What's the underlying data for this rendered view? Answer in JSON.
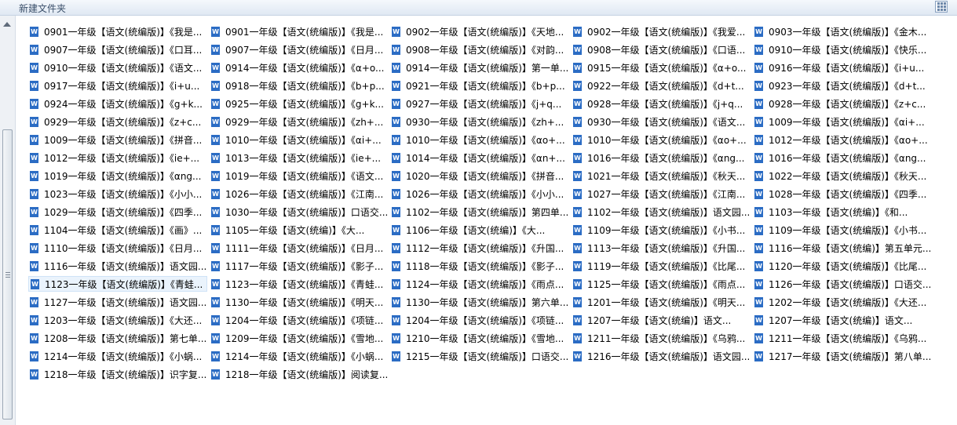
{
  "window": {
    "title": "新建文件夹"
  },
  "files": [
    "0901一年级【语文(统编版)】《我是...",
    "0901一年级【语文(统编版)】《我是...",
    "0902一年级【语文(统编版)】《天地...",
    "0902一年级【语文(统编版)】《我爱...",
    "0903一年级【语文(统编版)】《金木...",
    "0907一年级【语文(统编版)】《口耳...",
    "0907一年级【语文(统编版)】《日月...",
    "0908一年级【语文(统编版)】《对韵...",
    "0908一年级【语文(统编版)】《口语...",
    "0910一年级【语文(统编版)】《快乐...",
    "0910一年级【语文(统编版)】《语文...",
    "0914一年级【语文(统编版)】《α+o...",
    "0914一年级【语文(统编版)】第一单...",
    "0915一年级【语文(统编版)】《α+o...",
    "0916一年级【语文(统编版)】《i+u...",
    "0917一年级【语文(统编版)】《i+u...",
    "0918一年级【语文(统编版)】《b+p...",
    "0921一年级【语文(统编版)】《b+p...",
    "0922一年级【语文(统编版)】《d+t...",
    "0923一年级【语文(统编版)】《d+t...",
    "0924一年级【语文(统编版)】《g+k...",
    "0925一年级【语文(统编版)】《g+k...",
    "0927一年级【语文(统编版)】《j+q...",
    "0928一年级【语文(统编版)】《j+q...",
    "0928一年级【语文(统编版)】《z+c...",
    "0929一年级【语文(统编版)】《z+c...",
    "0929一年级【语文(统编版)】《zh+...",
    "0930一年级【语文(统编版)】《zh+...",
    "0930一年级【语文(统编版)】《语文...",
    "1009一年级【语文(统编版)】《αi+...",
    "1009一年级【语文(统编版)】《拼音...",
    "1010一年级【语文(统编版)】《αi+...",
    "1010一年级【语文(统编版)】《αo+...",
    "1010一年级【语文(统编版)】《αo+...",
    "1012一年级【语文(统编版)】《αo+...",
    "1012一年级【语文(统编版)】《ie+...",
    "1013一年级【语文(统编版)】《ie+...",
    "1014一年级【语文(统编版)】《αn+...",
    "1016一年级【语文(统编版)】《αng...",
    "1016一年级【语文(统编版)】《αng...",
    "1019一年级【语文(统编版)】《αng...",
    "1019一年级【语文(统编版)】《语文...",
    "1020一年级【语文(统编版)】《拼音...",
    "1021一年级【语文(统编版)】《秋天...",
    "1022一年级【语文(统编版)】《秋天...",
    "1023一年级【语文(统编版)】《小小...",
    "1026一年级【语文(统编版)】《江南...",
    "1026一年级【语文(统编版)】《小小...",
    "1027一年级【语文(统编版)】《江南...",
    "1028一年级【语文(统编版)】《四季...",
    "1029一年级【语文(统编版)】《四季...",
    "1030一年级【语文(统编版)】口语交...",
    "1102一年级【语文(统编版)】第四单...",
    "1102一年级【语文(统编版)】语文园...",
    "1103一年级【语文(统编)】《和...",
    "1104一年级【语文(统编版)】《画》...",
    "1105一年级【语文(统编)】《大...",
    "1106一年级【语文(统编)】《大...",
    "1109一年级【语文(统编版)】《小书...",
    "1109一年级【语文(统编版)】《小书...",
    "1110一年级【语文(统编版)】《日月...",
    "1111一年级【语文(统编版)】《日月...",
    "1112一年级【语文(统编版)】《升国...",
    "1113一年级【语文(统编版)】《升国...",
    "1116一年级【语文(统编)】第五单元...",
    "1116一年级【语文(统编版)】语文园...",
    "1117一年级【语文(统编版)】《影子...",
    "1118一年级【语文(统编版)】《影子...",
    "1119一年级【语文(统编版)】《比尾...",
    "1120一年级【语文(统编版)】《比尾...",
    "1123一年级【语文(统编版)】《青蛙...",
    "1123一年级【语文(统编版)】《青蛙...",
    "1124一年级【语文(统编版)】《雨点...",
    "1125一年级【语文(统编版)】《雨点...",
    "1126一年级【语文(统编版)】口语交...",
    "1127一年级【语文(统编版)】语文园...",
    "1130一年级【语文(统编版)】《明天...",
    "1130一年级【语文(统编版)】第六单...",
    "1201一年级【语文(统编版)】《明天...",
    "1202一年级【语文(统编版)】《大还...",
    "1203一年级【语文(统编版)】《大还...",
    "1204一年级【语文(统编版)】《项链...",
    "1204一年级【语文(统编版)】《项链...",
    "1207一年级【语文(统编)】语文...",
    "1207一年级【语文(统编)】语文...",
    "1208一年级【语文(统编版)】第七单...",
    "1209一年级【语文(统编版)】《雪地...",
    "1210一年级【语文(统编版)】《雪地...",
    "1211一年级【语文(统编版)】《乌鸦...",
    "1211一年级【语文(统编版)】《乌鸦...",
    "1214一年级【语文(统编版)】《小蜗...",
    "1214一年级【语文(统编版)】《小蜗...",
    "1215一年级【语文(统编版)】口语交...",
    "1216一年级【语文(统编版)】语文园...",
    "1217一年级【语文(统编版)】第八单...",
    "1218一年级【语文(统编版)】识字复...",
    "1218一年级【语文(统编版)】阅读复..."
  ],
  "selected_index": 70,
  "colors": {
    "word_icon": "#2b6cc4",
    "selection": "#eaf3fc"
  }
}
